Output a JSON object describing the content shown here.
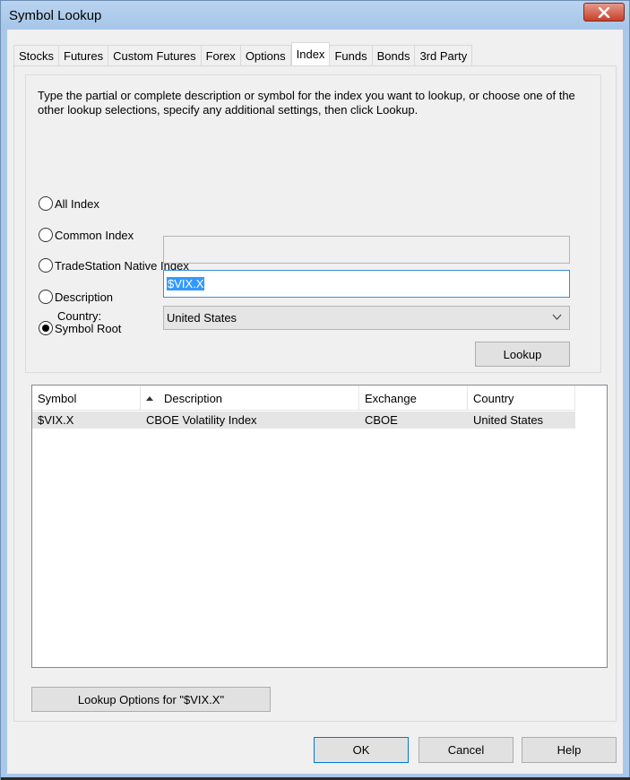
{
  "window": {
    "title": "Symbol Lookup"
  },
  "tabs": [
    {
      "label": "Stocks"
    },
    {
      "label": "Futures"
    },
    {
      "label": "Custom Futures"
    },
    {
      "label": "Forex"
    },
    {
      "label": "Options"
    },
    {
      "label": "Index",
      "active": true
    },
    {
      "label": "Funds"
    },
    {
      "label": "Bonds"
    },
    {
      "label": "3rd Party"
    }
  ],
  "search": {
    "instructions": "Type the partial or complete description or symbol for the index you want to lookup, or choose one of the other lookup selections, specify any additional settings, then click Lookup.",
    "options": [
      {
        "label": "All Index",
        "checked": false
      },
      {
        "label": "Common Index",
        "checked": false
      },
      {
        "label": "TradeStation Native Index",
        "checked": false
      },
      {
        "label": "Description",
        "checked": false
      },
      {
        "label": "Symbol Root",
        "checked": true
      }
    ],
    "description_value": "",
    "symbol_value": "$VIX.X",
    "country_label": "Country:",
    "country_value": "United States",
    "lookup_label": "Lookup"
  },
  "results": {
    "columns": [
      "Symbol",
      "Description",
      "Exchange",
      "Country"
    ],
    "sorted_column": "Description",
    "rows": [
      {
        "symbol": "$VIX.X",
        "description": "CBOE Volatility Index",
        "exchange": "CBOE",
        "country": "United States"
      }
    ]
  },
  "lookup_options_label": "Lookup Options for \"$VIX.X\"",
  "buttons": {
    "ok": "OK",
    "cancel": "Cancel",
    "help": "Help"
  },
  "colors": {
    "title_bar": "#a9c8ea",
    "close_button": "#c7402c",
    "selection": "#3399ff",
    "default_button_border": "#0078d7"
  },
  "icons": {
    "close": "close-icon",
    "dropdown": "chevron-down-icon",
    "sort": "sort-ascending-icon"
  }
}
